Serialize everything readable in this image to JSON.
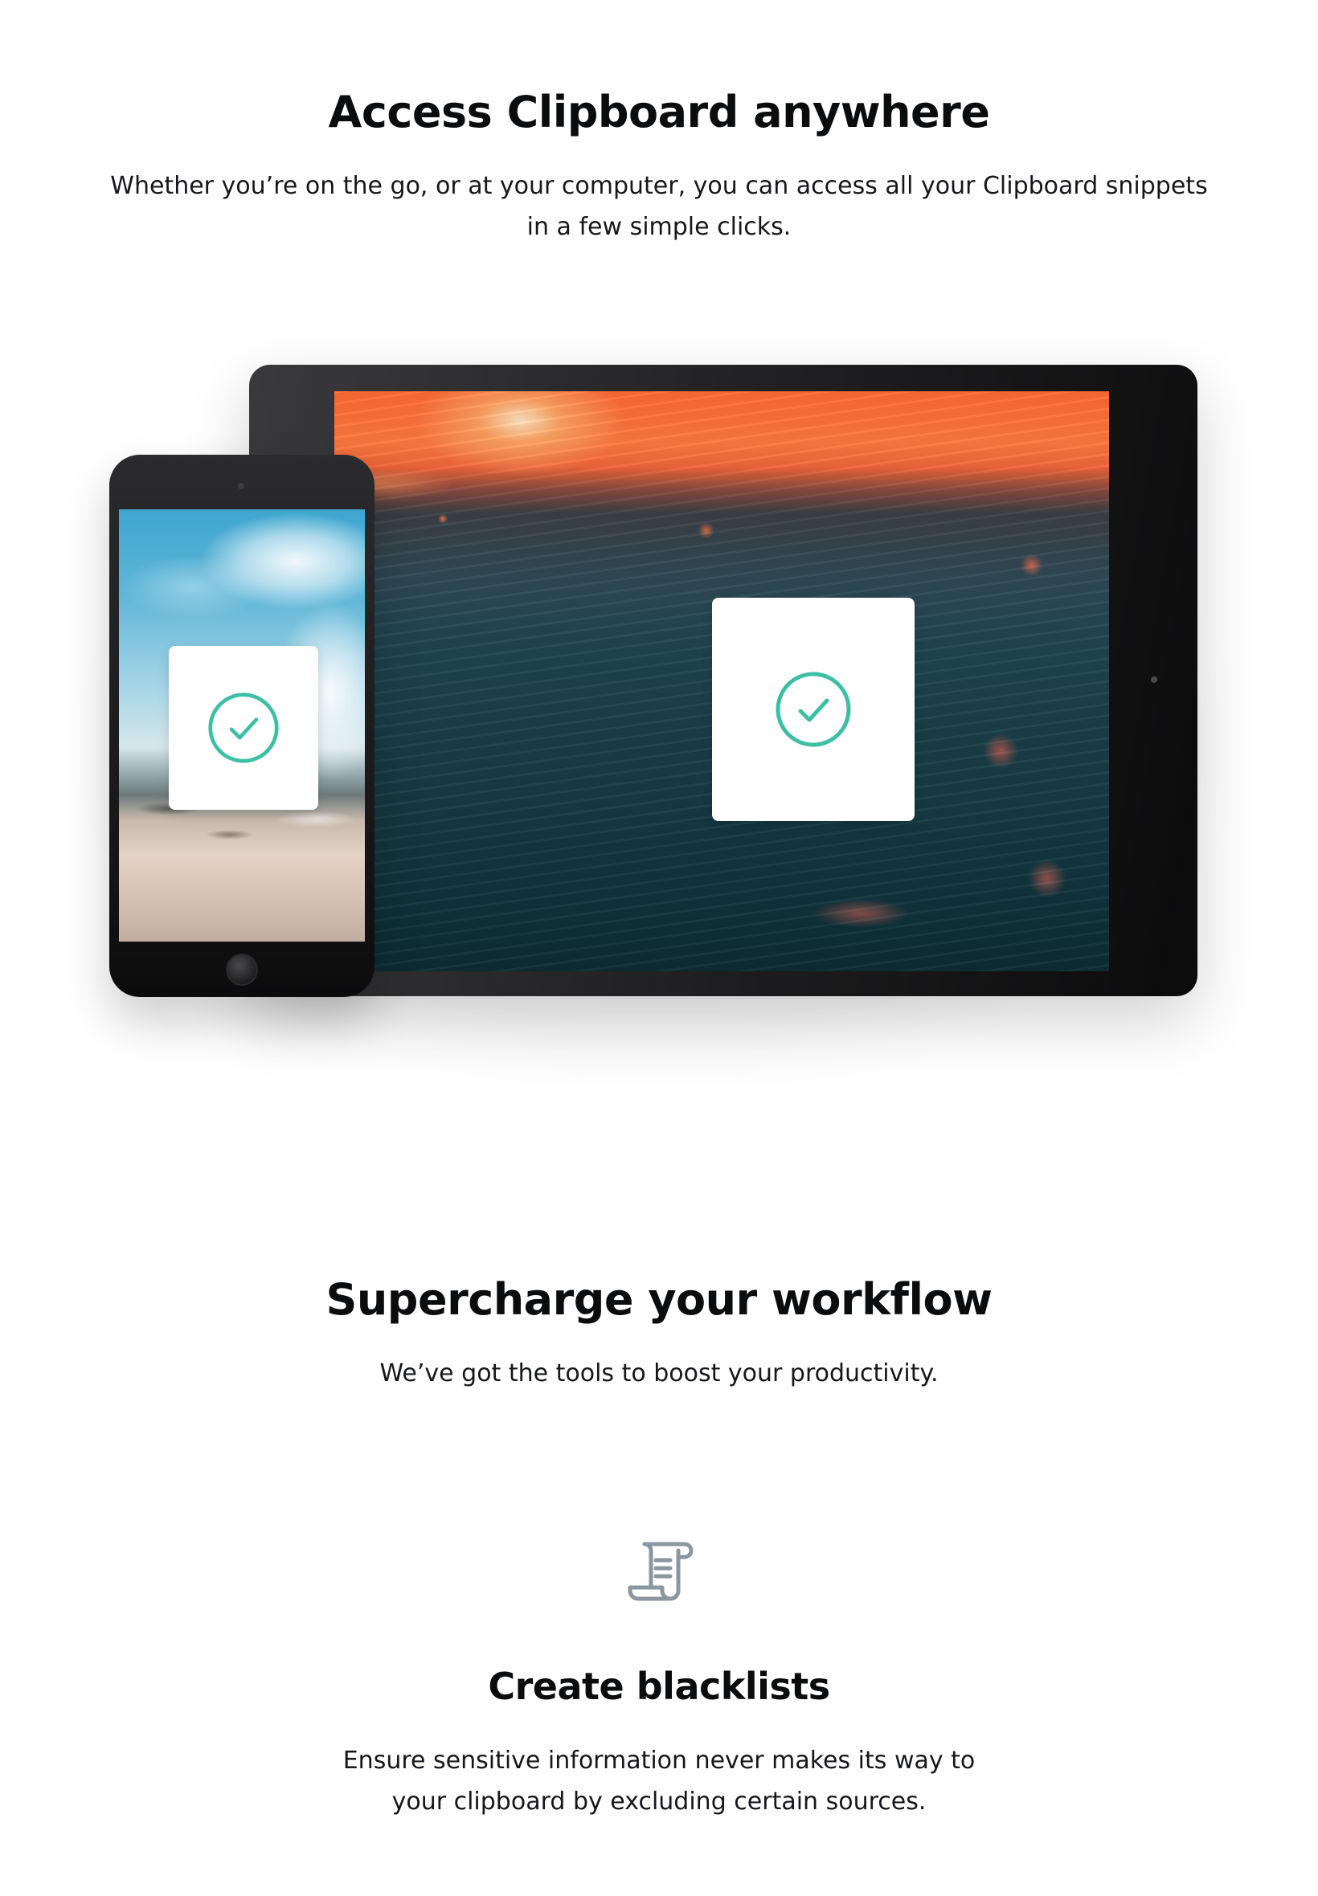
{
  "section_access": {
    "title": "Access Clipboard anywhere",
    "description": "Whether you’re on the go, or at your computer, you can access all your Clipboard snippets in a few simple clicks.",
    "check_color": "#3cbfa4"
  },
  "section_workflow": {
    "title": "Supercharge your workflow",
    "description": "We’ve got the tools to boost your productivity."
  },
  "feature": {
    "icon": "scroll-icon",
    "icon_color": "#8a96a0",
    "title": "Create blacklists",
    "description": "Ensure sensitive information never makes its way to your clipboard by excluding certain sources."
  }
}
